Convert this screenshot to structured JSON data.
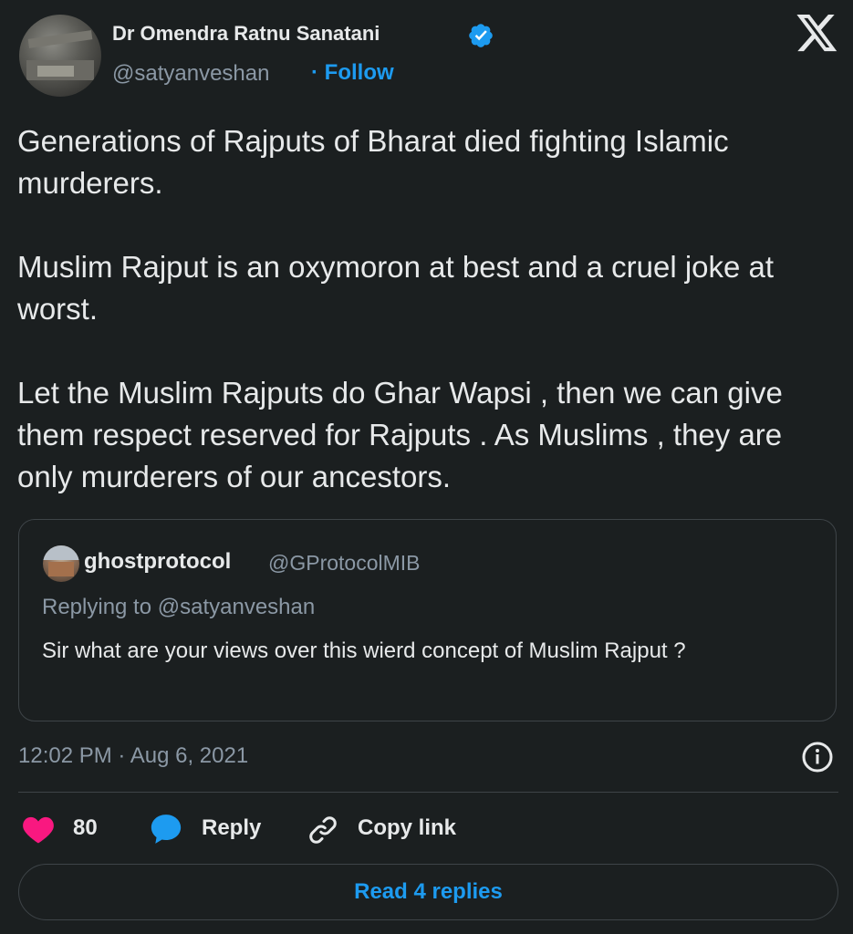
{
  "author": {
    "name": "Dr Omendra Ratnu Sanatani",
    "handle": "@satyanveshan",
    "follow_label": "· Follow",
    "verified_icon": "verified-badge-icon"
  },
  "tweet": {
    "paragraphs": [
      "Generations of Rajputs of Bharat died fighting Islamic murderers.",
      "Muslim Rajput is an oxymoron at best and a cruel joke at worst.",
      "Let the Muslim Rajputs do Ghar Wapsi , then we can give them respect reserved for Rajputs . As Muslims , they are only murderers of our ancestors."
    ],
    "timestamp": "12:02 PM · Aug 6, 2021"
  },
  "quoted": {
    "name": "ghostprotocol",
    "handle": "@GProtocolMIB",
    "replying_to": "Replying to @satyanveshan",
    "text": "Sir what are your views over this wierd concept of  Muslim Rajput ?"
  },
  "actions": {
    "likes": "80",
    "reply_label": "Reply",
    "copy_label": "Copy link"
  },
  "read_replies_label": "Read 4 replies",
  "colors": {
    "background": "#1b1f20",
    "accent": "#1d9bf0",
    "heart": "#f91880",
    "muted": "#8b98a5"
  }
}
